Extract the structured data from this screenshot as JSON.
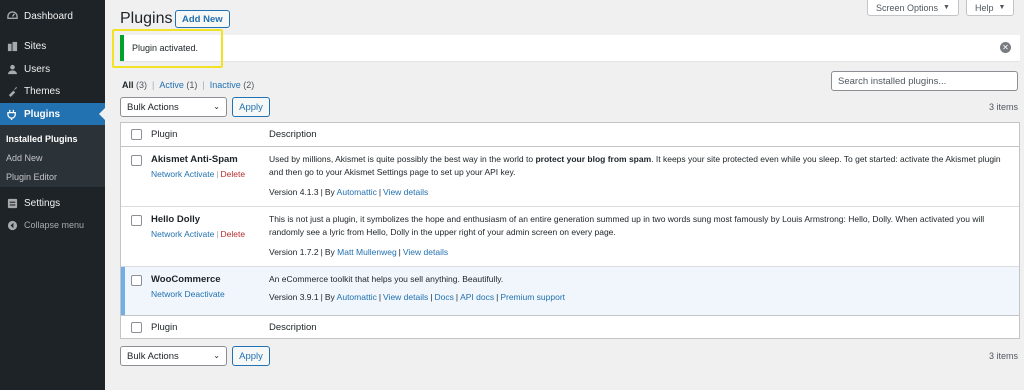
{
  "sidebar": {
    "items": [
      {
        "label": "Dashboard",
        "icon": "dashboard-icon"
      },
      {
        "label": "Sites",
        "icon": "sites-icon"
      },
      {
        "label": "Users",
        "icon": "users-icon"
      },
      {
        "label": "Themes",
        "icon": "themes-icon"
      },
      {
        "label": "Plugins",
        "icon": "plugins-icon"
      },
      {
        "label": "Settings",
        "icon": "settings-icon"
      },
      {
        "label": "Collapse menu",
        "icon": "collapse-icon"
      }
    ],
    "submenu": [
      "Installed Plugins",
      "Add New",
      "Plugin Editor"
    ]
  },
  "header": {
    "title": "Plugins",
    "add_new": "Add New",
    "screen_options": "Screen Options",
    "help": "Help"
  },
  "notice": {
    "text": "Plugin activated."
  },
  "filters": {
    "all": "All",
    "all_count": "(3)",
    "active": "Active",
    "active_count": "(1)",
    "inactive": "Inactive",
    "inactive_count": "(2)",
    "separator": "|"
  },
  "search": {
    "placeholder": "Search installed plugins..."
  },
  "bulk": {
    "label": "Bulk Actions",
    "apply": "Apply",
    "items_count": "3 items"
  },
  "table": {
    "col_plugin": "Plugin",
    "col_description": "Description",
    "rows": [
      {
        "name": "Akismet Anti-Spam",
        "action1": "Network Activate",
        "action2": "Delete",
        "desc_before": "Used by millions, Akismet is quite possibly the best way in the world to ",
        "desc_bold": "protect your blog from spam",
        "desc_after": ". It keeps your site protected even while you sleep. To get started: activate the Akismet plugin and then go to your Akismet Settings page to set up your API key.",
        "version": "Version 4.1.3",
        "by": "By",
        "author": "Automattic",
        "view_details": "View details"
      },
      {
        "name": "Hello Dolly",
        "action1": "Network Activate",
        "action2": "Delete",
        "desc": "This is not just a plugin, it symbolizes the hope and enthusiasm of an entire generation summed up in two words sung most famously by Louis Armstrong: Hello, Dolly. When activated you will randomly see a lyric from Hello, Dolly in the upper right of your admin screen on every page.",
        "version": "Version 1.7.2",
        "by": "By",
        "author": "Matt Mullenweg",
        "view_details": "View details"
      },
      {
        "name": "WooCommerce",
        "action1": "Network Deactivate",
        "desc": "An eCommerce toolkit that helps you sell anything. Beautifully.",
        "version": "Version 3.9.1",
        "by": "By",
        "author": "Automattic",
        "view_details": "View details",
        "docs": "Docs",
        "api_docs": "API docs",
        "premium_support": "Premium support"
      }
    ]
  },
  "colors": {
    "sidebar_bg": "#1d2327",
    "accent": "#2271b1",
    "success": "#00a32a",
    "highlight": "#f2e225",
    "delete": "#b32d2e"
  }
}
